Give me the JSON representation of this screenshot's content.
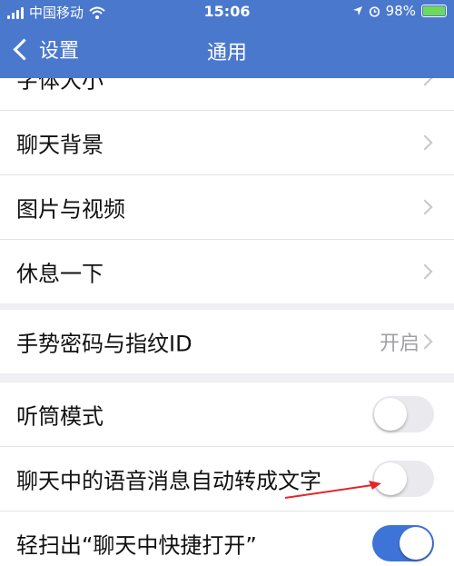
{
  "status_bar": {
    "carrier": "中国移动",
    "time": "15:06",
    "battery": "98%"
  },
  "nav": {
    "back_label": "设置",
    "title": "通用"
  },
  "group1": [
    {
      "label": "字体大小"
    },
    {
      "label": "聊天背景"
    },
    {
      "label": "图片与视频"
    },
    {
      "label": "休息一下"
    }
  ],
  "group2": [
    {
      "label": "手势密码与指纹ID",
      "value": "开启"
    }
  ],
  "group3": [
    {
      "label": "听筒模式",
      "toggle_on": false
    },
    {
      "label": "聊天中的语音消息自动转成文字",
      "toggle_on": false
    },
    {
      "label": "轻扫出“聊天中快捷打开”",
      "toggle_on": true
    }
  ],
  "colors": {
    "accent": "#4a78cd",
    "toggle_on": "#3e73d8",
    "annotation_arrow": "#e0262d"
  }
}
